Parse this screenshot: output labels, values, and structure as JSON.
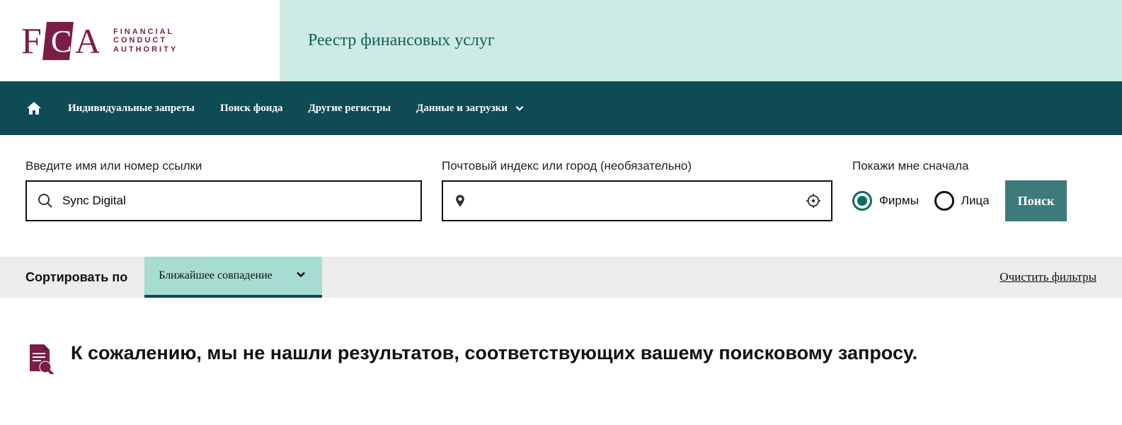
{
  "header": {
    "logo_line1": "FINANCIAL",
    "logo_line2": "CONDUCT",
    "logo_line3": "AUTHORITY",
    "site_title": "Реестр финансовых услуг"
  },
  "nav": {
    "items": [
      {
        "label": "Индивидуальные запреты",
        "has_dropdown": false
      },
      {
        "label": "Поиск фонда",
        "has_dropdown": false
      },
      {
        "label": "Другие регистры",
        "has_dropdown": false
      },
      {
        "label": "Данные и загрузки",
        "has_dropdown": true
      }
    ]
  },
  "search": {
    "name_label": "Введите имя или номер ссылки",
    "name_value": "Sync Digital",
    "location_label": "Почтовый индекс или город (необязательно)",
    "location_value": "",
    "show_first_label": "Покажи мне сначала",
    "radio_firms": "Фирмы",
    "radio_individuals": "Лица",
    "search_button": "Поиск"
  },
  "sort": {
    "label": "Сортировать по",
    "selected": "Ближайшее совпадение",
    "clear_filters": "Очистить фильтры"
  },
  "results": {
    "no_results_message": "К сожалению, мы не нашли результатов, соответствующих вашему поисковому запросу."
  }
}
